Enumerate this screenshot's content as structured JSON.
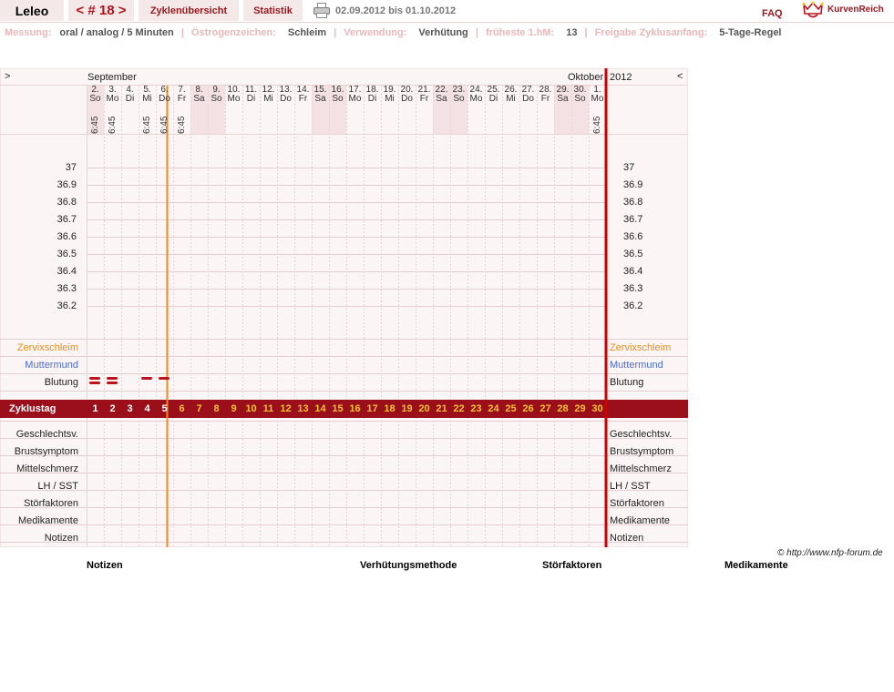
{
  "header": {
    "user_name": "Leleo",
    "cycle_label": "< # 18 >",
    "overview_label": "Zyklenübersicht",
    "stats_label": "Statistik",
    "date_range": "02.09.2012 bis 01.10.2012",
    "faq_label": "FAQ",
    "logo_text": "KurvenReich",
    "printer_icon": "printer-icon"
  },
  "info": {
    "measure_label": "Messung:",
    "measure_value": "oral / analog / 5 Minuten",
    "estrogen_label": "Östrogenzeichen:",
    "estrogen_value": "Schleim",
    "usage_label": "Verwendung:",
    "usage_value": "Verhütung",
    "earliest_label": "früheste 1.hM:",
    "earliest_value": "13",
    "release_label": "Freigabe Zyklusanfang:",
    "release_value": "5-Tage-Regel"
  },
  "chart": {
    "nav_prev": ">",
    "nav_next": "<",
    "month_start": "September",
    "month_end": "Oktober",
    "year": "2012",
    "days": [
      {
        "d": "2.",
        "w": "So",
        "t": "6:45",
        "weekend": true
      },
      {
        "d": "3.",
        "w": "Mo",
        "t": "6:45",
        "weekend": false
      },
      {
        "d": "4.",
        "w": "Di",
        "t": "",
        "weekend": false
      },
      {
        "d": "5.",
        "w": "Mi",
        "t": "6:45",
        "weekend": false
      },
      {
        "d": "6.",
        "w": "Do",
        "t": "6:45",
        "weekend": false
      },
      {
        "d": "7.",
        "w": "Fr",
        "t": "6:45",
        "weekend": false
      },
      {
        "d": "8.",
        "w": "Sa",
        "t": "",
        "weekend": true
      },
      {
        "d": "9.",
        "w": "So",
        "t": "",
        "weekend": true
      },
      {
        "d": "10.",
        "w": "Mo",
        "t": "",
        "weekend": false
      },
      {
        "d": "11.",
        "w": "Di",
        "t": "",
        "weekend": false
      },
      {
        "d": "12.",
        "w": "Mi",
        "t": "",
        "weekend": false
      },
      {
        "d": "13.",
        "w": "Do",
        "t": "",
        "weekend": false
      },
      {
        "d": "14.",
        "w": "Fr",
        "t": "",
        "weekend": false
      },
      {
        "d": "15.",
        "w": "Sa",
        "t": "",
        "weekend": true
      },
      {
        "d": "16.",
        "w": "So",
        "t": "",
        "weekend": true
      },
      {
        "d": "17.",
        "w": "Mo",
        "t": "",
        "weekend": false
      },
      {
        "d": "18.",
        "w": "Di",
        "t": "",
        "weekend": false
      },
      {
        "d": "19.",
        "w": "Mi",
        "t": "",
        "weekend": false
      },
      {
        "d": "20.",
        "w": "Do",
        "t": "",
        "weekend": false
      },
      {
        "d": "21.",
        "w": "Fr",
        "t": "",
        "weekend": false
      },
      {
        "d": "22.",
        "w": "Sa",
        "t": "",
        "weekend": true
      },
      {
        "d": "23.",
        "w": "So",
        "t": "",
        "weekend": true
      },
      {
        "d": "24.",
        "w": "Mo",
        "t": "",
        "weekend": false
      },
      {
        "d": "25.",
        "w": "Di",
        "t": "",
        "weekend": false
      },
      {
        "d": "26.",
        "w": "Mi",
        "t": "",
        "weekend": false
      },
      {
        "d": "27.",
        "w": "Do",
        "t": "",
        "weekend": false
      },
      {
        "d": "28.",
        "w": "Fr",
        "t": "",
        "weekend": false
      },
      {
        "d": "29.",
        "w": "Sa",
        "t": "",
        "weekend": true
      },
      {
        "d": "30.",
        "w": "So",
        "t": "",
        "weekend": true
      },
      {
        "d": "1.",
        "w": "Mo",
        "t": "6:45",
        "weekend": false
      }
    ],
    "temp_ticks": [
      "37",
      "36.9",
      "36.8",
      "36.7",
      "36.6",
      "36.5",
      "36.4",
      "36.3",
      "36.2"
    ],
    "rows": {
      "cervical": "Zervixschleim",
      "cervix": "Muttermund",
      "bleeding": "Blutung",
      "cycle_day": "Zyklustag",
      "intercourse": "Geschlechtsv.",
      "breast": "Brustsymptom",
      "midpain": "Mittelschmerz",
      "lh": "LH / SST",
      "disturb": "Störfaktoren",
      "meds": "Medikamente",
      "notes": "Notizen"
    },
    "bleeding": [
      2,
      2,
      0,
      1,
      1,
      0,
      0,
      0,
      0,
      0,
      0,
      0,
      0,
      0,
      0,
      0,
      0,
      0,
      0,
      0,
      0,
      0,
      0,
      0,
      0,
      0,
      0,
      0,
      0,
      0
    ],
    "cycle_days": [
      "1",
      "2",
      "3",
      "4",
      "5",
      "6",
      "7",
      "8",
      "9",
      "10",
      "11",
      "12",
      "13",
      "14",
      "15",
      "16",
      "17",
      "18",
      "19",
      "20",
      "21",
      "22",
      "23",
      "24",
      "25",
      "26",
      "27",
      "28",
      "29",
      "30"
    ],
    "colors": {
      "accent": "#9a1a20",
      "cycle_bar": "#9b0f1b",
      "fertile_num": "#f6c234",
      "orange_line": "#f08a1c",
      "red_line": "#cc0000",
      "cervical": "#e8901c",
      "cervix": "#4a6bd0",
      "weekend": "#f3e1e3"
    }
  },
  "footer": {
    "copyright": "© http://www.nfp-forum.de",
    "notes": "Notizen",
    "method": "Verhütungsmethode",
    "disturb": "Störfaktoren",
    "meds": "Medikamente"
  }
}
